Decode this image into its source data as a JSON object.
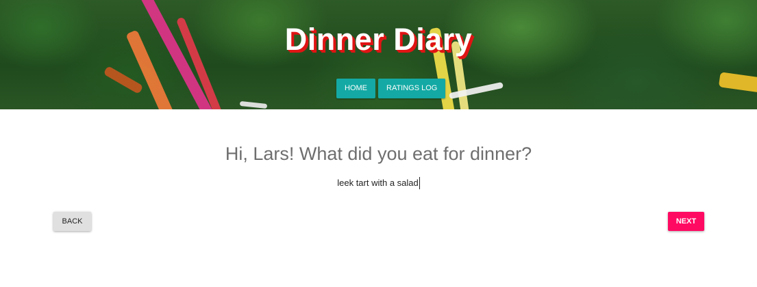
{
  "header": {
    "title": "Dinner Diary",
    "nav": [
      {
        "label": "HOME"
      },
      {
        "label": "RATINGS LOG"
      }
    ]
  },
  "main": {
    "question": "Hi, Lars! What did you eat for dinner?",
    "answer_value": "leek tart with a salad"
  },
  "actions": {
    "back_label": "BACK",
    "next_label": "NEXT"
  },
  "colors": {
    "title_shadow": "#e01414",
    "nav_accent": "#14a9a4",
    "next_accent": "#ff0a63",
    "back_bg": "#e0e0e0"
  }
}
